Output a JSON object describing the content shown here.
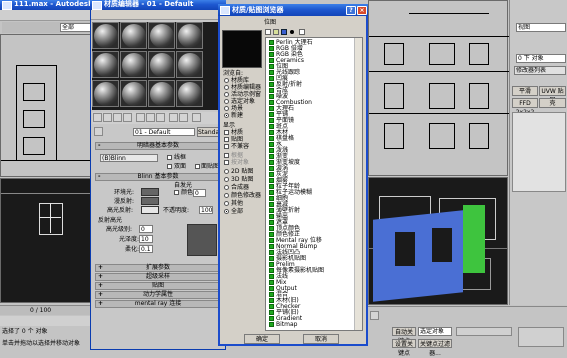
{
  "main_window": {
    "title": "111.max - Autodesk 3ds",
    "viewport_label": "全部"
  },
  "material_editor": {
    "title": "材质编辑器 - 01 - Default",
    "material_name": "01 - Default",
    "material_type_button": "Standard",
    "shader_basic_params": {
      "title": "明暗器基本参数",
      "shader": "(B)Blinn",
      "options": [
        "线框",
        "双面",
        "面贴图",
        "面状"
      ]
    },
    "blinn_params": {
      "title": "Blinn 基本参数",
      "self_illum_label": "自发光",
      "color_label": "颜色",
      "color_value": "0",
      "ambient": "环境光:",
      "diffuse": "漫反射:",
      "specular": "高光反射:",
      "opacity_label": "不透明度:",
      "opacity_value": "100"
    },
    "specular_highlights": {
      "title": "反射高光",
      "level_label": "高光级别:",
      "level_value": "0",
      "gloss_label": "光泽度:",
      "gloss_value": "10",
      "soften_label": "柔化:",
      "soften_value": "0.1"
    },
    "rollouts": [
      "扩展参数",
      "超级采样",
      "贴图",
      "动力学属性",
      "mental ray 连接"
    ]
  },
  "browser": {
    "title": "材质/贴图浏览器",
    "section_label": "位图",
    "browse_from_label": "浏览自:",
    "browse_from": [
      "材质库",
      "材质编辑器",
      "活动示例窗",
      "选定对象",
      "场景",
      "新建"
    ],
    "browse_from_selected": 5,
    "show_label": "显示",
    "show_options": [
      "材质",
      "贴图",
      "不兼容"
    ],
    "filter_options": [
      "根据",
      "按对象"
    ],
    "map_type_options": [
      "2D 贴图",
      "3D 贴图",
      "合成器",
      "颜色修改器",
      "其他",
      "全部"
    ],
    "map_type_selected": 5,
    "items": [
      "Perlin 大理石",
      "RGB 倍增",
      "RGB 染色",
      "Ceramics",
      "位图",
      "光线跟踪",
      "凹痕",
      "反射/折射",
      "合成",
      "噪波",
      "Combustion",
      "大理石",
      "平铺",
      "平面镜",
      "斑点",
      "木材",
      "棋盘格",
      "水",
      "泼溅",
      "渐变",
      "渐变坡度",
      "漩涡",
      "灰泥",
      "烟雾",
      "粒子年龄",
      "粒子运动模糊",
      "细胞",
      "衰减",
      "薄壁折射",
      "输出",
      "遮罩",
      "顶点颜色",
      "颜色修正",
      "Mental ray 位移",
      "Normal Bump",
      "法线凹凸",
      "摄影机贴图",
      "Prelim",
      "每像素摄影机贴图",
      "法线",
      "Mix",
      "Output",
      "混合",
      "木材(旧)",
      "Checker",
      "平铺(旧)",
      "Gradient",
      "Bitmap"
    ],
    "ok_button": "确定",
    "cancel_button": "取消"
  },
  "right_panel": {
    "dropdown": "视图",
    "object_name": "0 下 对象",
    "modifier_list": "修改器列表",
    "buttons": [
      "平滑",
      "UVW 贴图",
      "FFD 2x2x2",
      "壳"
    ]
  },
  "status": {
    "selection": "选择了 0 个 对象",
    "prompt": "单击并拖动以选择并移动对象",
    "frame": "0 / 100",
    "auto_key": "自动关键点",
    "set_key": "设置关键点",
    "selected_object": "选定对象",
    "key_filters": "关键点过滤器..."
  }
}
